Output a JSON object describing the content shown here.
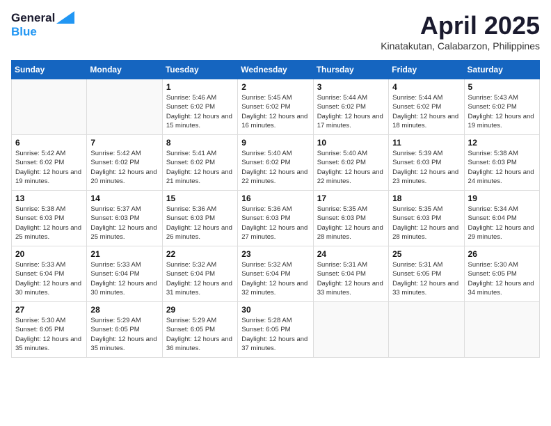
{
  "header": {
    "logo_general": "General",
    "logo_blue": "Blue",
    "title": "April 2025",
    "location": "Kinatakutan, Calabarzon, Philippines"
  },
  "weekdays": [
    "Sunday",
    "Monday",
    "Tuesday",
    "Wednesday",
    "Thursday",
    "Friday",
    "Saturday"
  ],
  "weeks": [
    [
      {
        "day": "",
        "sunrise": "",
        "sunset": "",
        "daylight": ""
      },
      {
        "day": "",
        "sunrise": "",
        "sunset": "",
        "daylight": ""
      },
      {
        "day": "1",
        "sunrise": "Sunrise: 5:46 AM",
        "sunset": "Sunset: 6:02 PM",
        "daylight": "Daylight: 12 hours and 15 minutes."
      },
      {
        "day": "2",
        "sunrise": "Sunrise: 5:45 AM",
        "sunset": "Sunset: 6:02 PM",
        "daylight": "Daylight: 12 hours and 16 minutes."
      },
      {
        "day": "3",
        "sunrise": "Sunrise: 5:44 AM",
        "sunset": "Sunset: 6:02 PM",
        "daylight": "Daylight: 12 hours and 17 minutes."
      },
      {
        "day": "4",
        "sunrise": "Sunrise: 5:44 AM",
        "sunset": "Sunset: 6:02 PM",
        "daylight": "Daylight: 12 hours and 18 minutes."
      },
      {
        "day": "5",
        "sunrise": "Sunrise: 5:43 AM",
        "sunset": "Sunset: 6:02 PM",
        "daylight": "Daylight: 12 hours and 19 minutes."
      }
    ],
    [
      {
        "day": "6",
        "sunrise": "Sunrise: 5:42 AM",
        "sunset": "Sunset: 6:02 PM",
        "daylight": "Daylight: 12 hours and 19 minutes."
      },
      {
        "day": "7",
        "sunrise": "Sunrise: 5:42 AM",
        "sunset": "Sunset: 6:02 PM",
        "daylight": "Daylight: 12 hours and 20 minutes."
      },
      {
        "day": "8",
        "sunrise": "Sunrise: 5:41 AM",
        "sunset": "Sunset: 6:02 PM",
        "daylight": "Daylight: 12 hours and 21 minutes."
      },
      {
        "day": "9",
        "sunrise": "Sunrise: 5:40 AM",
        "sunset": "Sunset: 6:02 PM",
        "daylight": "Daylight: 12 hours and 22 minutes."
      },
      {
        "day": "10",
        "sunrise": "Sunrise: 5:40 AM",
        "sunset": "Sunset: 6:02 PM",
        "daylight": "Daylight: 12 hours and 22 minutes."
      },
      {
        "day": "11",
        "sunrise": "Sunrise: 5:39 AM",
        "sunset": "Sunset: 6:03 PM",
        "daylight": "Daylight: 12 hours and 23 minutes."
      },
      {
        "day": "12",
        "sunrise": "Sunrise: 5:38 AM",
        "sunset": "Sunset: 6:03 PM",
        "daylight": "Daylight: 12 hours and 24 minutes."
      }
    ],
    [
      {
        "day": "13",
        "sunrise": "Sunrise: 5:38 AM",
        "sunset": "Sunset: 6:03 PM",
        "daylight": "Daylight: 12 hours and 25 minutes."
      },
      {
        "day": "14",
        "sunrise": "Sunrise: 5:37 AM",
        "sunset": "Sunset: 6:03 PM",
        "daylight": "Daylight: 12 hours and 25 minutes."
      },
      {
        "day": "15",
        "sunrise": "Sunrise: 5:36 AM",
        "sunset": "Sunset: 6:03 PM",
        "daylight": "Daylight: 12 hours and 26 minutes."
      },
      {
        "day": "16",
        "sunrise": "Sunrise: 5:36 AM",
        "sunset": "Sunset: 6:03 PM",
        "daylight": "Daylight: 12 hours and 27 minutes."
      },
      {
        "day": "17",
        "sunrise": "Sunrise: 5:35 AM",
        "sunset": "Sunset: 6:03 PM",
        "daylight": "Daylight: 12 hours and 28 minutes."
      },
      {
        "day": "18",
        "sunrise": "Sunrise: 5:35 AM",
        "sunset": "Sunset: 6:03 PM",
        "daylight": "Daylight: 12 hours and 28 minutes."
      },
      {
        "day": "19",
        "sunrise": "Sunrise: 5:34 AM",
        "sunset": "Sunset: 6:04 PM",
        "daylight": "Daylight: 12 hours and 29 minutes."
      }
    ],
    [
      {
        "day": "20",
        "sunrise": "Sunrise: 5:33 AM",
        "sunset": "Sunset: 6:04 PM",
        "daylight": "Daylight: 12 hours and 30 minutes."
      },
      {
        "day": "21",
        "sunrise": "Sunrise: 5:33 AM",
        "sunset": "Sunset: 6:04 PM",
        "daylight": "Daylight: 12 hours and 30 minutes."
      },
      {
        "day": "22",
        "sunrise": "Sunrise: 5:32 AM",
        "sunset": "Sunset: 6:04 PM",
        "daylight": "Daylight: 12 hours and 31 minutes."
      },
      {
        "day": "23",
        "sunrise": "Sunrise: 5:32 AM",
        "sunset": "Sunset: 6:04 PM",
        "daylight": "Daylight: 12 hours and 32 minutes."
      },
      {
        "day": "24",
        "sunrise": "Sunrise: 5:31 AM",
        "sunset": "Sunset: 6:04 PM",
        "daylight": "Daylight: 12 hours and 33 minutes."
      },
      {
        "day": "25",
        "sunrise": "Sunrise: 5:31 AM",
        "sunset": "Sunset: 6:05 PM",
        "daylight": "Daylight: 12 hours and 33 minutes."
      },
      {
        "day": "26",
        "sunrise": "Sunrise: 5:30 AM",
        "sunset": "Sunset: 6:05 PM",
        "daylight": "Daylight: 12 hours and 34 minutes."
      }
    ],
    [
      {
        "day": "27",
        "sunrise": "Sunrise: 5:30 AM",
        "sunset": "Sunset: 6:05 PM",
        "daylight": "Daylight: 12 hours and 35 minutes."
      },
      {
        "day": "28",
        "sunrise": "Sunrise: 5:29 AM",
        "sunset": "Sunset: 6:05 PM",
        "daylight": "Daylight: 12 hours and 35 minutes."
      },
      {
        "day": "29",
        "sunrise": "Sunrise: 5:29 AM",
        "sunset": "Sunset: 6:05 PM",
        "daylight": "Daylight: 12 hours and 36 minutes."
      },
      {
        "day": "30",
        "sunrise": "Sunrise: 5:28 AM",
        "sunset": "Sunset: 6:05 PM",
        "daylight": "Daylight: 12 hours and 37 minutes."
      },
      {
        "day": "",
        "sunrise": "",
        "sunset": "",
        "daylight": ""
      },
      {
        "day": "",
        "sunrise": "",
        "sunset": "",
        "daylight": ""
      },
      {
        "day": "",
        "sunrise": "",
        "sunset": "",
        "daylight": ""
      }
    ]
  ]
}
